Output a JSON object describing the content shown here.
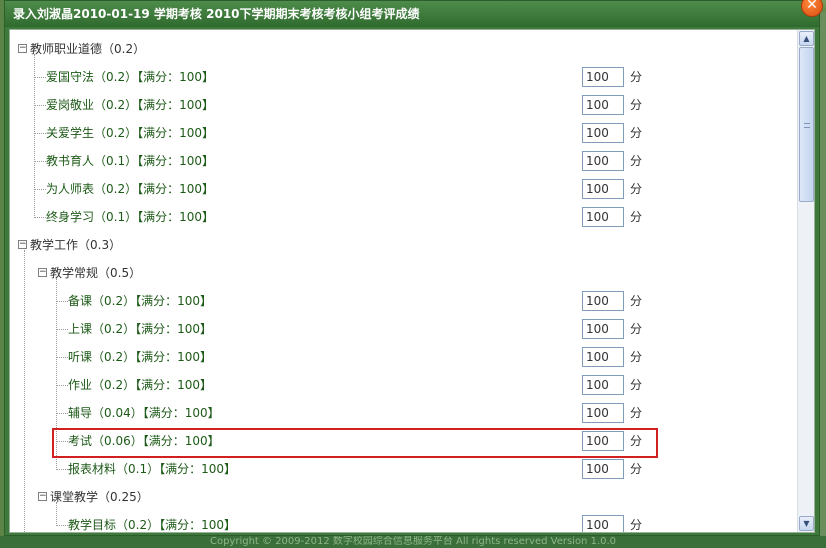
{
  "dialog": {
    "title": "录入刘淑晶2010-01-19 学期考核 2010下学期期末考核考核小组考评成绩",
    "close_label": "✕"
  },
  "footer": {
    "text": "Copyright © 2009-2012 数字校园综合信息服务平台 All rights reserved Version 1.0.0"
  },
  "tree": {
    "groups": [
      {
        "label": "教师职业道德（0.2）",
        "items": [
          {
            "label": "爱国守法（0.2）【满分：100】",
            "value": "100"
          },
          {
            "label": "爱岗敬业（0.2）【满分：100】",
            "value": "100"
          },
          {
            "label": "关爱学生（0.2）【满分：100】",
            "value": "100"
          },
          {
            "label": "教书育人（0.1）【满分：100】",
            "value": "100"
          },
          {
            "label": "为人师表（0.2）【满分：100】",
            "value": "100"
          },
          {
            "label": "终身学习（0.1）【满分：100】",
            "value": "100"
          }
        ]
      },
      {
        "label": "教学工作（0.3）",
        "subgroups": [
          {
            "label": "教学常规（0.5）",
            "items": [
              {
                "label": "备课（0.2）【满分：100】",
                "value": "100"
              },
              {
                "label": "上课（0.2）【满分：100】",
                "value": "100"
              },
              {
                "label": "听课（0.2）【满分：100】",
                "value": "100"
              },
              {
                "label": "作业（0.2）【满分：100】",
                "value": "100"
              },
              {
                "label": "辅导（0.04）【满分：100】",
                "value": "100"
              },
              {
                "label": "考试（0.06）【满分：100】",
                "value": "100"
              },
              {
                "label": "报表材料（0.1）【满分：100】",
                "value": "100"
              }
            ]
          },
          {
            "label": "课堂教学（0.25）",
            "items": [
              {
                "label": "教学目标（0.2）【满分：100】",
                "value": "100"
              }
            ]
          }
        ]
      }
    ],
    "unit": "分"
  },
  "colors": {
    "title_bar": "#3f7a3d",
    "leaf_text": "#1d5a17",
    "highlight": "#d21f1f"
  },
  "icons": {
    "close": "close-icon",
    "scroll_up": "scroll-up-icon",
    "scroll_down": "scroll-down-icon"
  }
}
